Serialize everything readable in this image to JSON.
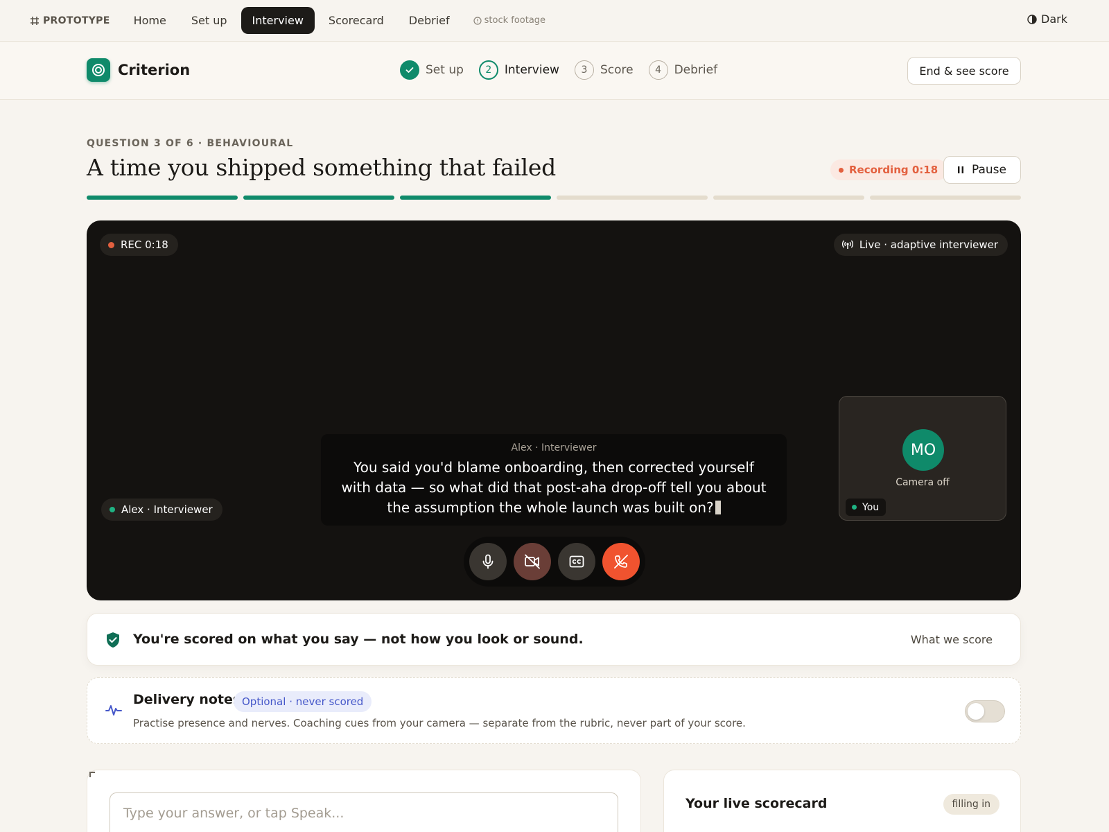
{
  "proto": {
    "label": "PROTOTYPE",
    "nav": [
      "Home",
      "Set up",
      "Interview",
      "Scorecard",
      "Debrief"
    ],
    "active": "Interview",
    "stock": "stock footage",
    "dark": "Dark"
  },
  "header": {
    "brand": "Criterion",
    "steps": [
      {
        "num": "",
        "label": "Set up",
        "state": "done"
      },
      {
        "num": "2",
        "label": "Interview",
        "state": "current"
      },
      {
        "num": "3",
        "label": "Score",
        "state": "upcoming"
      },
      {
        "num": "4",
        "label": "Debrief",
        "state": "upcoming"
      }
    ],
    "end_button": "End & see score"
  },
  "question": {
    "eyebrow": "QUESTION 3 OF 6 · BEHAVIOURAL",
    "title": "A time you shipped something that failed",
    "recording": "Recording 0:18",
    "pause": "Pause",
    "progress": {
      "total": 6,
      "completed": 3
    }
  },
  "stage": {
    "rec": "REC 0:18",
    "live": "Live · adaptive interviewer",
    "interviewer": "Alex · Interviewer",
    "caption_speaker": "Alex · Interviewer",
    "caption_text": "You said you'd blame onboarding, then corrected yourself with data — so what did that post-aha drop-off tell you about the assumption the whole launch was built on?",
    "self": {
      "initials": "MO",
      "status": "Camera off",
      "label": "You"
    }
  },
  "notice": {
    "text": "You're scored on what you say — not how you look or sound.",
    "link": "What we score"
  },
  "delivery": {
    "title": "Delivery notes",
    "badge": "Optional · never scored",
    "desc": "Practise presence and nerves. Coaching cues from your camera — separate from the rubric, never part of your score.",
    "enabled": false
  },
  "answer": {
    "placeholder": "Type your answer, or tap Speak..."
  },
  "scorecard": {
    "title": "Your live scorecard",
    "status": "filling in"
  },
  "colors": {
    "accent": "#0f8a6a",
    "record": "#e3603f",
    "hangup": "#f0532f",
    "badge": "#4557c9"
  }
}
